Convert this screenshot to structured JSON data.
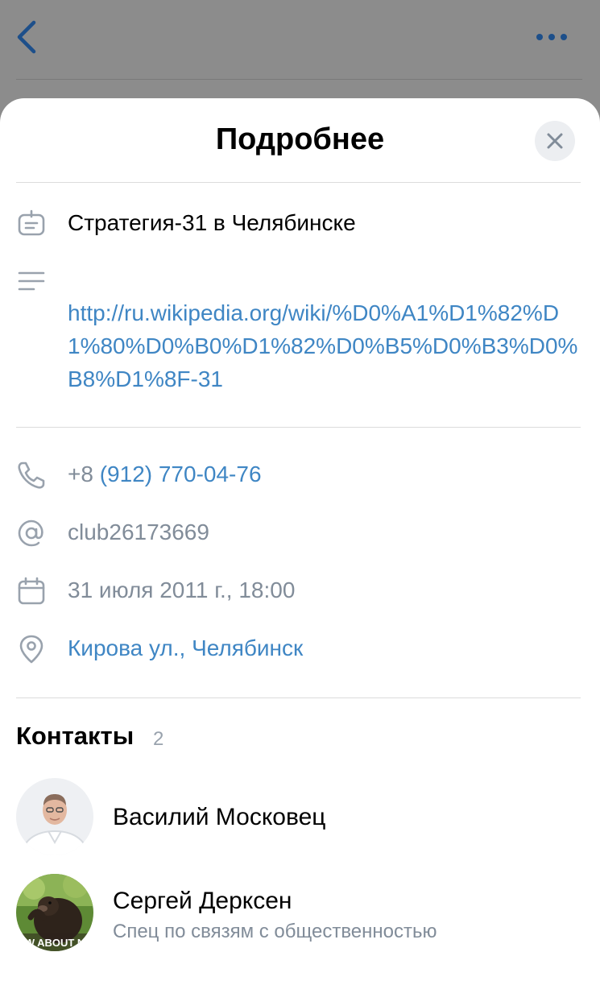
{
  "header": {
    "back_icon": "chevron-left-icon",
    "more_icon": "more-horizontal-icon"
  },
  "sheet": {
    "title": "Подробнее",
    "close_icon": "close-icon"
  },
  "details": {
    "name": "Стратегия-31 в Челябинске",
    "description_link": "http://ru.wikipedia.org/wiki/%D0%A1%D1%82%D1%80%D0%B0%D1%82%D0%B5%D0%B3%D0%B8%D1%8F-31",
    "phone_prefix": "+8",
    "phone_number": "(912) 770-04-76",
    "screen_name": "club26173669",
    "date": "31 июля 2011 г., 18:00",
    "address": "Кирова ул., Челябинск"
  },
  "contacts": {
    "title": "Контакты",
    "count": "2",
    "items": [
      {
        "name": "Василий Московец",
        "role": ""
      },
      {
        "name": "Сергей Дерксен",
        "role": "Спец по связям с общественностью",
        "avatar_caption": "W ABOUT N"
      }
    ]
  },
  "colors": {
    "link": "#3f86c4",
    "secondary_text": "#818c99",
    "icon_gray": "#99a2ad"
  }
}
